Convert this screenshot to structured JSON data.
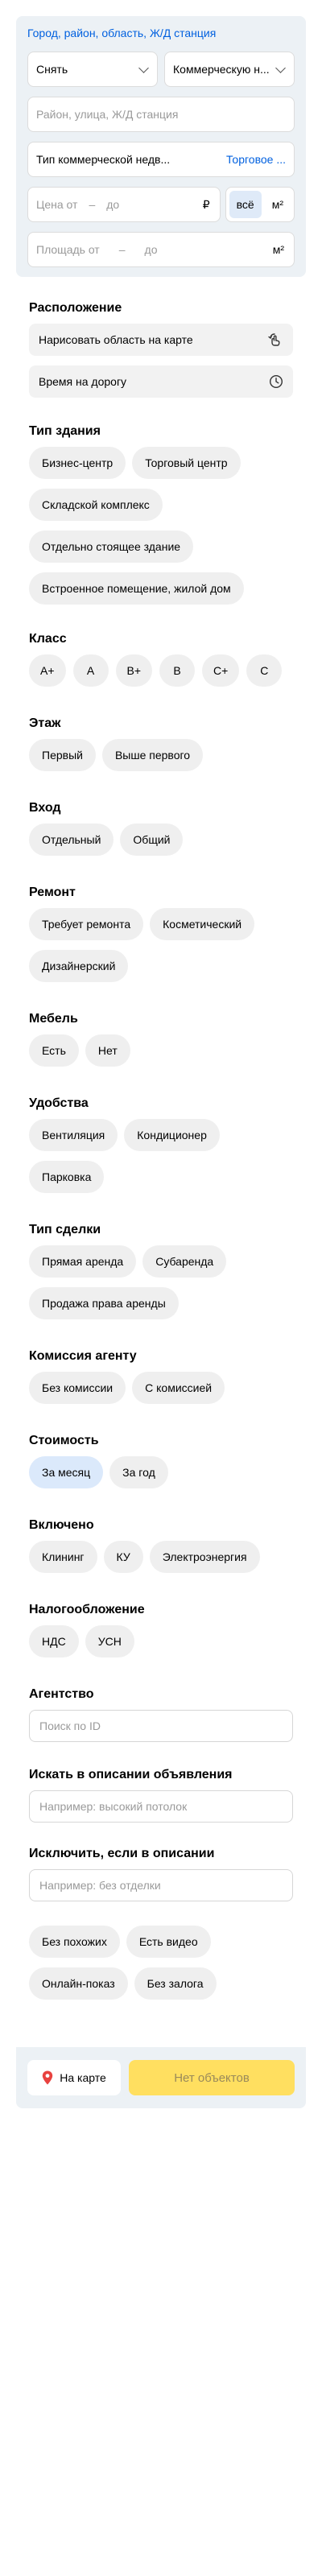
{
  "search": {
    "geo_link": "Город, район, область, Ж/Д станция",
    "deal_type": "Снять",
    "property_type": "Коммерческую н...",
    "address_placeholder": "Район, улица, Ж/Д станция",
    "commercial_type_label": "Тип коммерческой недв...",
    "commercial_type_value": "Торговое ...",
    "price_from": "Цена от",
    "price_to": "до",
    "currency": "₽",
    "price_mode_all": "всё",
    "price_mode_m2": "м²",
    "area_from": "Площадь от",
    "area_to": "до",
    "area_unit": "м²"
  },
  "location": {
    "title": "Расположение",
    "draw_on_map": "Нарисовать область на карте",
    "travel_time": "Время на дорогу"
  },
  "building_type": {
    "title": "Тип здания",
    "options": [
      "Бизнес-центр",
      "Торговый центр",
      "Складской комплекс",
      "Отдельно стоящее здание",
      "Встроенное помещение, жилой дом"
    ]
  },
  "class": {
    "title": "Класс",
    "options": [
      "A+",
      "A",
      "B+",
      "B",
      "C+",
      "C"
    ]
  },
  "floor": {
    "title": "Этаж",
    "options": [
      "Первый",
      "Выше первого"
    ]
  },
  "entrance": {
    "title": "Вход",
    "options": [
      "Отдельный",
      "Общий"
    ]
  },
  "renovation": {
    "title": "Ремонт",
    "options": [
      "Требует ремонта",
      "Косметический",
      "Дизайнерский"
    ]
  },
  "furniture": {
    "title": "Мебель",
    "options": [
      "Есть",
      "Нет"
    ]
  },
  "amenities": {
    "title": "Удобства",
    "options": [
      "Вентиляция",
      "Кондиционер",
      "Парковка"
    ]
  },
  "deal_kind": {
    "title": "Тип сделки",
    "options": [
      "Прямая аренда",
      "Субаренда",
      "Продажа права аренды"
    ]
  },
  "agent_fee": {
    "title": "Комиссия агенту",
    "options": [
      "Без комиссии",
      "С комиссией"
    ]
  },
  "cost": {
    "title": "Стоимость",
    "options": [
      "За месяц",
      "За год"
    ],
    "selected": "За месяц",
    "selected_color": "#dbe9fb"
  },
  "included": {
    "title": "Включено",
    "options": [
      "Клининг",
      "КУ",
      "Электроэнергия"
    ]
  },
  "taxation": {
    "title": "Налогообложение",
    "options": [
      "НДС",
      "УСН"
    ]
  },
  "agency": {
    "title": "Агентство",
    "placeholder": "Поиск по ID"
  },
  "description_include": {
    "title": "Искать в описании объявления",
    "placeholder": "Например: высокий потолок"
  },
  "description_exclude": {
    "title": "Исключить, если в описании",
    "placeholder": "Например: без отделки"
  },
  "extras": {
    "options": [
      "Без похожих",
      "Есть видео",
      "Онлайн-показ",
      "Без залога"
    ]
  },
  "footer": {
    "map_button": "На карте",
    "results_button": "Нет объектов",
    "results_color": "#ffdf60",
    "pin_color": "#e8423f"
  }
}
